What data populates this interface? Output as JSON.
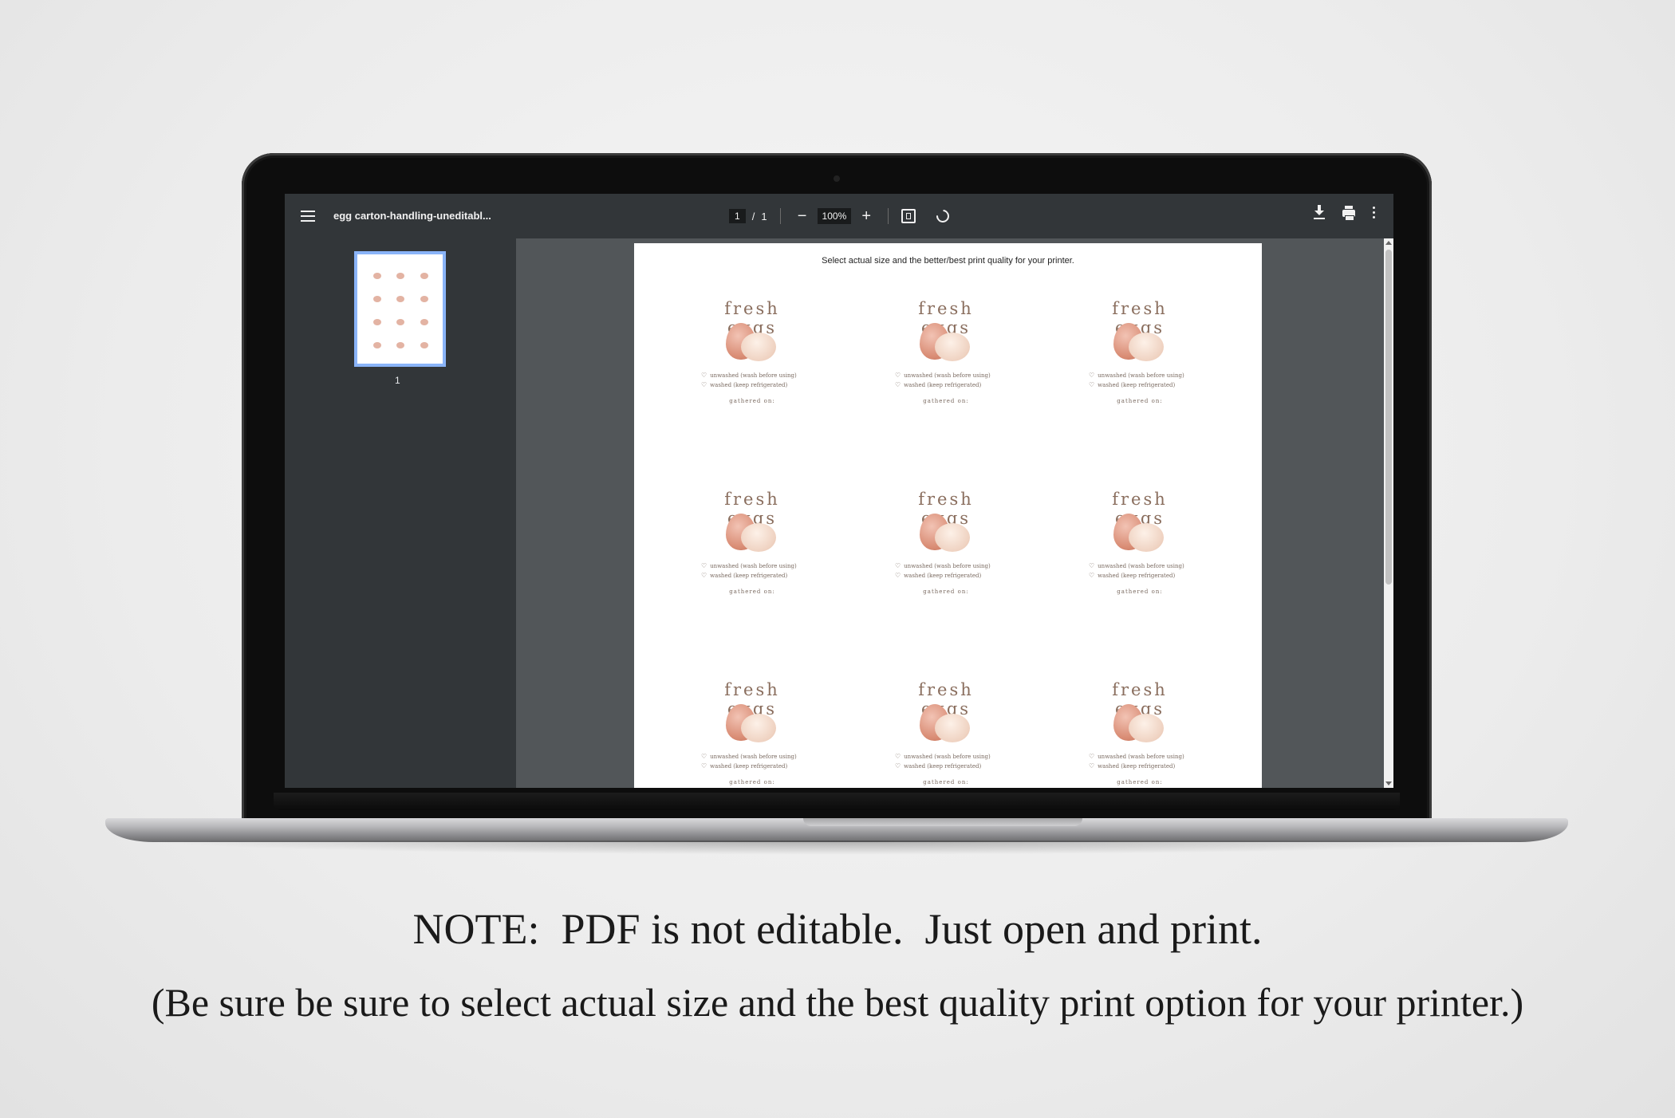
{
  "viewer": {
    "file_title": "egg carton-handling-uneditabl...",
    "page_current": "1",
    "page_sep": "/",
    "page_total": "1",
    "zoom": "100%",
    "zoom_out": "−",
    "zoom_in": "+",
    "thumbnail_label": "1"
  },
  "page": {
    "note": "Select actual size and the better/best print quality for your printer.",
    "labels": [
      {
        "title": "fresh eggs",
        "line1": "unwashed (wash before using)",
        "line2": "washed (keep refrigerated)",
        "gathered": "gathered on:"
      },
      {
        "title": "fresh eggs",
        "line1": "unwashed (wash before using)",
        "line2": "washed (keep refrigerated)",
        "gathered": "gathered on:"
      },
      {
        "title": "fresh eggs",
        "line1": "unwashed (wash before using)",
        "line2": "washed (keep refrigerated)",
        "gathered": "gathered on:"
      },
      {
        "title": "fresh eggs",
        "line1": "unwashed (wash before using)",
        "line2": "washed (keep refrigerated)",
        "gathered": "gathered on:"
      },
      {
        "title": "fresh eggs",
        "line1": "unwashed (wash before using)",
        "line2": "washed (keep refrigerated)",
        "gathered": "gathered on:"
      },
      {
        "title": "fresh eggs",
        "line1": "unwashed (wash before using)",
        "line2": "washed (keep refrigerated)",
        "gathered": "gathered on:"
      },
      {
        "title": "fresh eggs",
        "line1": "unwashed (wash before using)",
        "line2": "washed (keep refrigerated)",
        "gathered": "gathered on:"
      },
      {
        "title": "fresh eggs",
        "line1": "unwashed (wash before using)",
        "line2": "washed (keep refrigerated)",
        "gathered": "gathered on:"
      },
      {
        "title": "fresh eggs",
        "line1": "unwashed (wash before using)",
        "line2": "washed (keep refrigerated)",
        "gathered": "gathered on:"
      }
    ]
  },
  "caption": {
    "line1": "NOTE:  PDF is not editable.  Just open and print.",
    "line2": "(Be sure be sure to select actual size and the best quality print option for your printer.)"
  }
}
